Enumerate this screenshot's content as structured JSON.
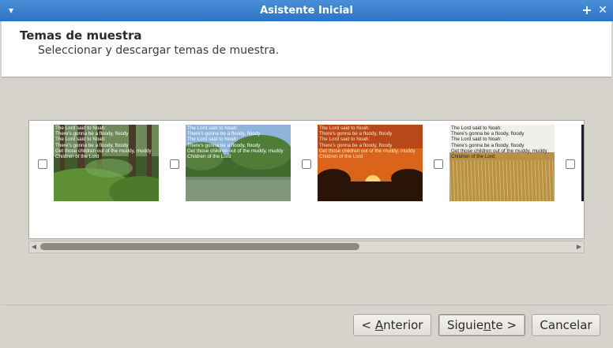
{
  "window": {
    "title": "Asistente Inicial"
  },
  "header": {
    "title": "Temas de muestra",
    "subtitle": "Seleccionar y descargar temas de muestra."
  },
  "themes": [
    {
      "checked": false,
      "lines": [
        {
          "text": "The Lord said to Noah:",
          "color": "#ffffff"
        },
        {
          "text": "There's gonna be a floody, floody",
          "color": "#ffffff"
        },
        {
          "text": "The Lord said to Noah:",
          "color": "#ffffff"
        },
        {
          "text": "There's gonna be a floody, floody",
          "color": "#ffffff"
        },
        {
          "text": "Get those children out of the muddy, muddy",
          "color": "#ffffff"
        },
        {
          "text": "Children of the Lord",
          "color": "#ffffff"
        }
      ],
      "scene": "forest"
    },
    {
      "checked": false,
      "lines": [
        {
          "text": "The Lord said to Noah:",
          "color": "#ffffff"
        },
        {
          "text": "There's gonna be a floody, floody",
          "color": "#ffffff"
        },
        {
          "text": "The Lord said to Noah:",
          "color": "#ffffff"
        },
        {
          "text": "There's gonna be a floody, floody",
          "color": "#ffffff"
        },
        {
          "text": "Get those children out of the muddy, muddy",
          "color": "#ffffff"
        },
        {
          "text": "Children of the Lord",
          "color": "#ffffff"
        }
      ],
      "scene": "lake"
    },
    {
      "checked": false,
      "lines": [
        {
          "text": "The Lord said to Noah:",
          "color": "#ffe9c0"
        },
        {
          "text": "There's gonna be a floody, floody",
          "color": "#ffe9c0"
        },
        {
          "text": "The Lord said to Noah:",
          "color": "#ffe9c0"
        },
        {
          "text": "There's gonna be a floody, floody",
          "color": "#ffe9c0"
        },
        {
          "text": "Get those children out of the muddy, muddy",
          "color": "#ffe9c0"
        },
        {
          "text": "Children of the Lord",
          "color": "#ffe9c0"
        }
      ],
      "scene": "sunset"
    },
    {
      "checked": false,
      "lines": [
        {
          "text": "The Lord said to Noah:",
          "color": "#222222"
        },
        {
          "text": "There's gonna be a floody, floody",
          "color": "#222222"
        },
        {
          "text": "The Lord said to Noah:",
          "color": "#222222"
        },
        {
          "text": "There's gonna be a floody, floody",
          "color": "#222222"
        },
        {
          "text": "Get those children out of the muddy, muddy",
          "color": "#222222"
        },
        {
          "text": "Children of the Lord",
          "color": "#222222"
        }
      ],
      "scene": "wheat"
    },
    {
      "checked": false,
      "lines": [],
      "scene": "dark"
    }
  ],
  "buttons": {
    "back_prefix": "< ",
    "back_mnemonic": "A",
    "back_rest": "nterior",
    "next_prefix": "Siguie",
    "next_mnemonic": "n",
    "next_rest": "te >",
    "cancel": "Cancelar"
  },
  "scroll": {
    "position": 0.0
  },
  "colors": {
    "titlebar": "#3b82cf",
    "window_bg": "#d6d2cc"
  },
  "icons": {
    "menu": "chevron-down-icon",
    "maximize": "plus-icon",
    "close": "close-icon"
  }
}
